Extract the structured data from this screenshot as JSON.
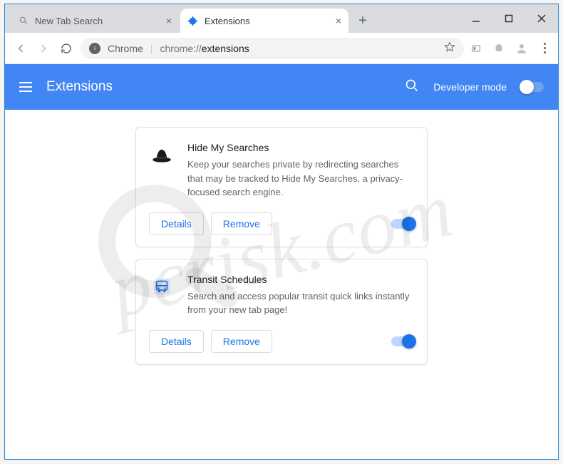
{
  "window": {
    "tabs": [
      {
        "label": "New Tab Search",
        "active": false,
        "icon": "search"
      },
      {
        "label": "Extensions",
        "active": true,
        "icon": "puzzle"
      }
    ]
  },
  "addressbar": {
    "chip": "Chrome",
    "host": "chrome://",
    "path": "extensions"
  },
  "appbar": {
    "title": "Extensions",
    "devmode_label": "Developer mode",
    "devmode_on": false
  },
  "buttons": {
    "details": "Details",
    "remove": "Remove"
  },
  "extensions": [
    {
      "name": "Hide My Searches",
      "description": "Keep your searches private by redirecting searches that may be tracked to Hide My Searches, a privacy-focused search engine.",
      "icon": "hat",
      "enabled": true
    },
    {
      "name": "Transit Schedules",
      "description": "Search and access popular transit quick links instantly from your new tab page!",
      "icon": "bus",
      "enabled": true
    }
  ],
  "watermark": {
    "text": "pcrisk.com"
  }
}
